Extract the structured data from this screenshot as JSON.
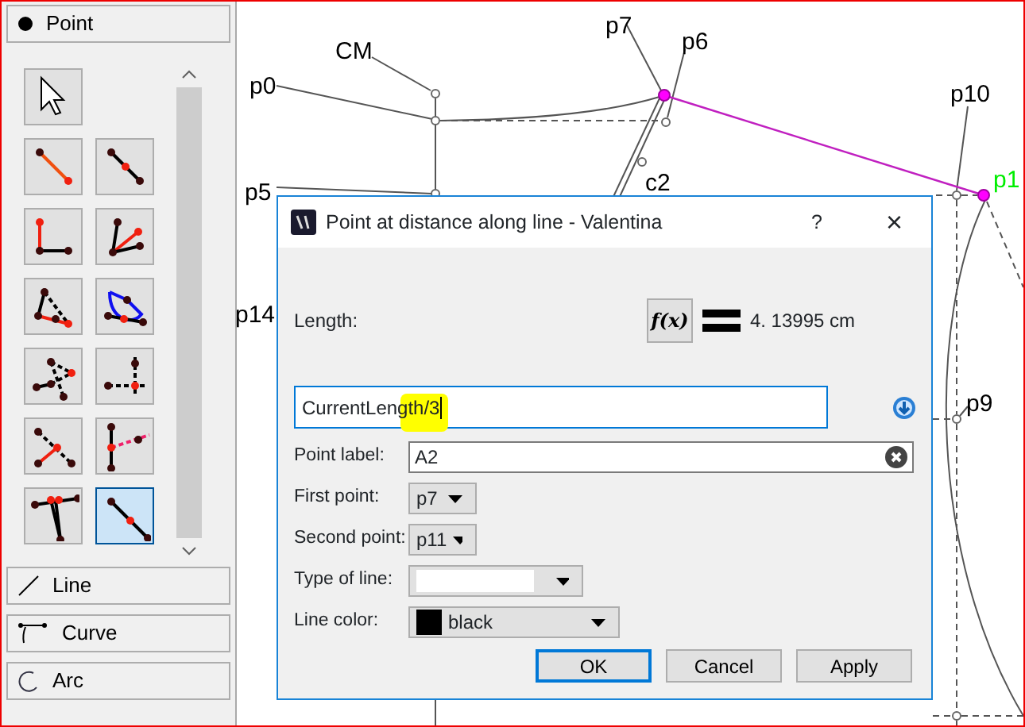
{
  "sidebar": {
    "groups": [
      {
        "label": "Point"
      },
      {
        "label": "Line"
      },
      {
        "label": "Curve"
      },
      {
        "label": "Arc"
      }
    ],
    "tools": [
      {
        "selected": false
      },
      {
        "selected": false
      },
      {
        "selected": false
      },
      {
        "selected": false
      },
      {
        "selected": false
      },
      {
        "selected": false
      },
      {
        "selected": false
      },
      {
        "selected": false
      },
      {
        "selected": false
      },
      {
        "selected": false
      },
      {
        "selected": false
      },
      {
        "selected": false
      },
      {
        "selected": true
      }
    ]
  },
  "canvas": {
    "labels": [
      {
        "text": "CM",
        "color": "#000000"
      },
      {
        "text": "p0",
        "color": "#000000"
      },
      {
        "text": "p7",
        "color": "#000000"
      },
      {
        "text": "p6",
        "color": "#000000"
      },
      {
        "text": "p10",
        "color": "#000000"
      },
      {
        "text": "p1",
        "color": "#00ee00"
      },
      {
        "text": "p5",
        "color": "#000000"
      },
      {
        "text": "c2",
        "color": "#000000"
      },
      {
        "text": "p14",
        "color": "#000000"
      },
      {
        "text": "p9",
        "color": "#000000"
      }
    ]
  },
  "dialog": {
    "title": "Point at distance along line - Valentina",
    "help": "?",
    "close": "×",
    "length_label": "Length:",
    "formula_button": "f(x)",
    "result": "4. 13995 cm",
    "formula": "CurrentLength/3",
    "fields": [
      {
        "kind": "text",
        "label": "Point label:",
        "value": "A2"
      },
      {
        "kind": "combo",
        "label": "First point:",
        "value": "p7"
      },
      {
        "kind": "combo",
        "label": "Second point:",
        "value": "p11"
      },
      {
        "kind": "line",
        "label": "Type of line:"
      },
      {
        "kind": "color",
        "label": "Line color:",
        "value": "black",
        "color": "#000000"
      }
    ],
    "buttons": [
      {
        "label": "OK",
        "default": true
      },
      {
        "label": "Cancel",
        "default": false
      },
      {
        "label": "Apply",
        "default": false
      }
    ]
  }
}
